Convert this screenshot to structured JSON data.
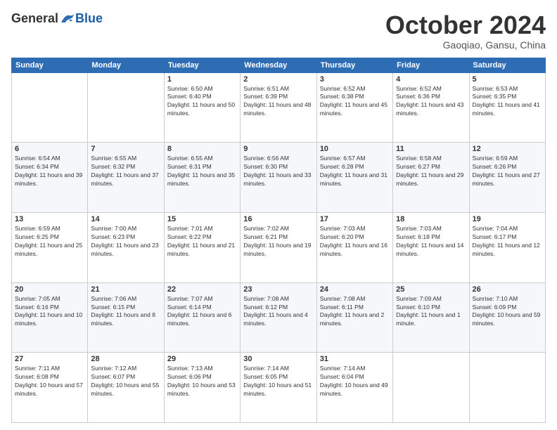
{
  "logo": {
    "general": "General",
    "blue": "Blue"
  },
  "header": {
    "month": "October 2024",
    "location": "Gaoqiao, Gansu, China"
  },
  "weekdays": [
    "Sunday",
    "Monday",
    "Tuesday",
    "Wednesday",
    "Thursday",
    "Friday",
    "Saturday"
  ],
  "weeks": [
    [
      {
        "day": "",
        "info": ""
      },
      {
        "day": "",
        "info": ""
      },
      {
        "day": "1",
        "info": "Sunrise: 6:50 AM\nSunset: 6:40 PM\nDaylight: 11 hours and 50 minutes."
      },
      {
        "day": "2",
        "info": "Sunrise: 6:51 AM\nSunset: 6:39 PM\nDaylight: 11 hours and 48 minutes."
      },
      {
        "day": "3",
        "info": "Sunrise: 6:52 AM\nSunset: 6:38 PM\nDaylight: 11 hours and 45 minutes."
      },
      {
        "day": "4",
        "info": "Sunrise: 6:52 AM\nSunset: 6:36 PM\nDaylight: 11 hours and 43 minutes."
      },
      {
        "day": "5",
        "info": "Sunrise: 6:53 AM\nSunset: 6:35 PM\nDaylight: 11 hours and 41 minutes."
      }
    ],
    [
      {
        "day": "6",
        "info": "Sunrise: 6:54 AM\nSunset: 6:34 PM\nDaylight: 11 hours and 39 minutes."
      },
      {
        "day": "7",
        "info": "Sunrise: 6:55 AM\nSunset: 6:32 PM\nDaylight: 11 hours and 37 minutes."
      },
      {
        "day": "8",
        "info": "Sunrise: 6:55 AM\nSunset: 6:31 PM\nDaylight: 11 hours and 35 minutes."
      },
      {
        "day": "9",
        "info": "Sunrise: 6:56 AM\nSunset: 6:30 PM\nDaylight: 11 hours and 33 minutes."
      },
      {
        "day": "10",
        "info": "Sunrise: 6:57 AM\nSunset: 6:28 PM\nDaylight: 11 hours and 31 minutes."
      },
      {
        "day": "11",
        "info": "Sunrise: 6:58 AM\nSunset: 6:27 PM\nDaylight: 11 hours and 29 minutes."
      },
      {
        "day": "12",
        "info": "Sunrise: 6:59 AM\nSunset: 6:26 PM\nDaylight: 11 hours and 27 minutes."
      }
    ],
    [
      {
        "day": "13",
        "info": "Sunrise: 6:59 AM\nSunset: 6:25 PM\nDaylight: 11 hours and 25 minutes."
      },
      {
        "day": "14",
        "info": "Sunrise: 7:00 AM\nSunset: 6:23 PM\nDaylight: 11 hours and 23 minutes."
      },
      {
        "day": "15",
        "info": "Sunrise: 7:01 AM\nSunset: 6:22 PM\nDaylight: 11 hours and 21 minutes."
      },
      {
        "day": "16",
        "info": "Sunrise: 7:02 AM\nSunset: 6:21 PM\nDaylight: 11 hours and 19 minutes."
      },
      {
        "day": "17",
        "info": "Sunrise: 7:03 AM\nSunset: 6:20 PM\nDaylight: 11 hours and 16 minutes."
      },
      {
        "day": "18",
        "info": "Sunrise: 7:03 AM\nSunset: 6:18 PM\nDaylight: 11 hours and 14 minutes."
      },
      {
        "day": "19",
        "info": "Sunrise: 7:04 AM\nSunset: 6:17 PM\nDaylight: 11 hours and 12 minutes."
      }
    ],
    [
      {
        "day": "20",
        "info": "Sunrise: 7:05 AM\nSunset: 6:16 PM\nDaylight: 11 hours and 10 minutes."
      },
      {
        "day": "21",
        "info": "Sunrise: 7:06 AM\nSunset: 6:15 PM\nDaylight: 11 hours and 8 minutes."
      },
      {
        "day": "22",
        "info": "Sunrise: 7:07 AM\nSunset: 6:14 PM\nDaylight: 11 hours and 6 minutes."
      },
      {
        "day": "23",
        "info": "Sunrise: 7:08 AM\nSunset: 6:12 PM\nDaylight: 11 hours and 4 minutes."
      },
      {
        "day": "24",
        "info": "Sunrise: 7:08 AM\nSunset: 6:11 PM\nDaylight: 11 hours and 2 minutes."
      },
      {
        "day": "25",
        "info": "Sunrise: 7:09 AM\nSunset: 6:10 PM\nDaylight: 11 hours and 1 minute."
      },
      {
        "day": "26",
        "info": "Sunrise: 7:10 AM\nSunset: 6:09 PM\nDaylight: 10 hours and 59 minutes."
      }
    ],
    [
      {
        "day": "27",
        "info": "Sunrise: 7:11 AM\nSunset: 6:08 PM\nDaylight: 10 hours and 57 minutes."
      },
      {
        "day": "28",
        "info": "Sunrise: 7:12 AM\nSunset: 6:07 PM\nDaylight: 10 hours and 55 minutes."
      },
      {
        "day": "29",
        "info": "Sunrise: 7:13 AM\nSunset: 6:06 PM\nDaylight: 10 hours and 53 minutes."
      },
      {
        "day": "30",
        "info": "Sunrise: 7:14 AM\nSunset: 6:05 PM\nDaylight: 10 hours and 51 minutes."
      },
      {
        "day": "31",
        "info": "Sunrise: 7:14 AM\nSunset: 6:04 PM\nDaylight: 10 hours and 49 minutes."
      },
      {
        "day": "",
        "info": ""
      },
      {
        "day": "",
        "info": ""
      }
    ]
  ]
}
